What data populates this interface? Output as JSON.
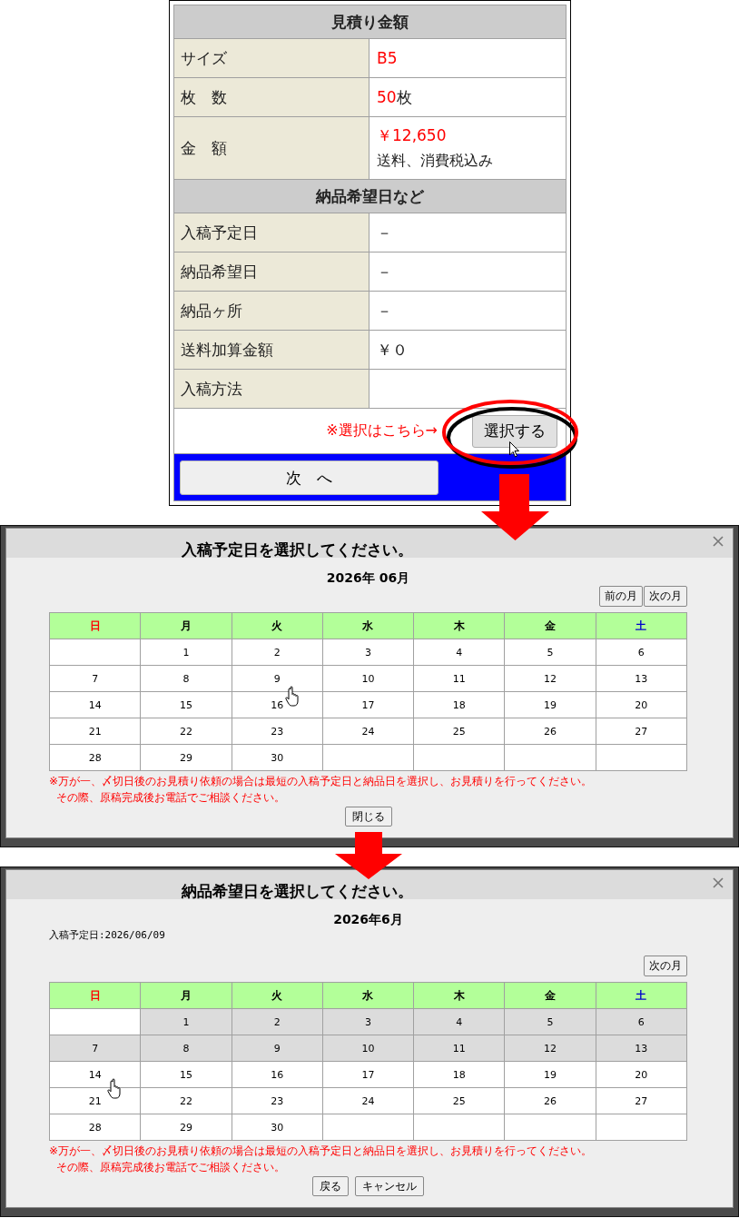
{
  "estimate_panel": {
    "sections": [
      {
        "heading": "見積り金額",
        "rows": [
          {
            "label": "サイズ",
            "value": "B5",
            "emphasized": true
          },
          {
            "label": "枚　数",
            "value": "50",
            "unit": "枚",
            "emphasized": true
          },
          {
            "label": "金　額",
            "value": "￥12,650",
            "emphasized": true,
            "note": "送料、消費税込み"
          }
        ]
      },
      {
        "heading": "納品希望日など",
        "rows": [
          {
            "label": "入稿予定日",
            "value": "－",
            "emphasized": false
          },
          {
            "label": "納品希望日",
            "value": "－",
            "emphasized": false
          },
          {
            "label": "納品ヶ所",
            "value": "－",
            "emphasized": false
          },
          {
            "label": "送料加算金額",
            "value": "￥０",
            "emphasized": false
          },
          {
            "label": "入稿方法"
          }
        ]
      }
    ],
    "select_hint": "※選択はこちら→",
    "select_button": "選択する",
    "next_button": "次　へ"
  },
  "dialogs": [
    {
      "title": "入稿予定日を選択してください。",
      "month": "2026年 06月",
      "nav_buttons": [
        "前の月",
        "次の月"
      ],
      "weekdays": [
        {
          "label": "日",
          "color": "#ff0000"
        },
        {
          "label": "月",
          "color": "#000000"
        },
        {
          "label": "火",
          "color": "#000000"
        },
        {
          "label": "水",
          "color": "#000000"
        },
        {
          "label": "木",
          "color": "#000000"
        },
        {
          "label": "金",
          "color": "#000000"
        },
        {
          "label": "土",
          "color": "#0000cc"
        }
      ],
      "weeks": [
        [
          {
            "day": "1",
            "disabled": false
          },
          {
            "day": "2",
            "disabled": false
          },
          {
            "day": "3",
            "disabled": false
          },
          {
            "day": "4",
            "disabled": false
          },
          {
            "day": "5",
            "disabled": false
          },
          {
            "day": "6",
            "disabled": false
          }
        ],
        [
          {
            "day": "7",
            "disabled": false
          },
          {
            "day": "8",
            "disabled": false
          },
          {
            "day": "9",
            "disabled": false
          },
          {
            "day": "10",
            "disabled": false
          },
          {
            "day": "11",
            "disabled": false
          },
          {
            "day": "12",
            "disabled": false
          },
          {
            "day": "13",
            "disabled": false
          }
        ],
        [
          {
            "day": "14",
            "disabled": false
          },
          {
            "day": "15",
            "disabled": false
          },
          {
            "day": "16",
            "disabled": false
          },
          {
            "day": "17",
            "disabled": false
          },
          {
            "day": "18",
            "disabled": false
          },
          {
            "day": "19",
            "disabled": false
          },
          {
            "day": "20",
            "disabled": false
          }
        ],
        [
          {
            "day": "21",
            "disabled": false
          },
          {
            "day": "22",
            "disabled": false
          },
          {
            "day": "23",
            "disabled": false
          },
          {
            "day": "24",
            "disabled": false
          },
          {
            "day": "25",
            "disabled": false
          },
          {
            "day": "26",
            "disabled": false
          },
          {
            "day": "27",
            "disabled": false
          }
        ],
        [
          {
            "day": "28",
            "disabled": false
          },
          {
            "day": "29",
            "disabled": false
          },
          {
            "day": "30",
            "disabled": false
          }
        ]
      ],
      "notes": [
        "※万が一、〆切日後のお見積り依頼の場合は最短の入稿予定日と納品日を選択し、お見積りを行ってください。",
        "その際、原稿完成後お電話でご相談ください。"
      ],
      "buttons": [
        "閉じる"
      ]
    },
    {
      "title": "納品希望日を選択してください。",
      "month": "2026年6月",
      "start_date": "入稿予定日:2026/06/09",
      "nav_buttons": [
        "次の月"
      ],
      "weekdays": [
        {
          "label": "日",
          "color": "#ff0000"
        },
        {
          "label": "月",
          "color": "#000000"
        },
        {
          "label": "火",
          "color": "#000000"
        },
        {
          "label": "水",
          "color": "#000000"
        },
        {
          "label": "木",
          "color": "#000000"
        },
        {
          "label": "金",
          "color": "#000000"
        },
        {
          "label": "土",
          "color": "#0000cc"
        }
      ],
      "weeks": [
        [
          {
            "day": "1",
            "disabled": true
          },
          {
            "day": "2",
            "disabled": true
          },
          {
            "day": "3",
            "disabled": true
          },
          {
            "day": "4",
            "disabled": true
          },
          {
            "day": "5",
            "disabled": true
          },
          {
            "day": "6",
            "disabled": true
          }
        ],
        [
          {
            "day": "7",
            "disabled": true
          },
          {
            "day": "8",
            "disabled": true
          },
          {
            "day": "9",
            "disabled": true
          },
          {
            "day": "10",
            "disabled": true
          },
          {
            "day": "11",
            "disabled": true
          },
          {
            "day": "12",
            "disabled": true
          },
          {
            "day": "13",
            "disabled": true
          }
        ],
        [
          {
            "day": "14",
            "disabled": false
          },
          {
            "day": "15",
            "disabled": false
          },
          {
            "day": "16",
            "disabled": false
          },
          {
            "day": "17",
            "disabled": false
          },
          {
            "day": "18",
            "disabled": false
          },
          {
            "day": "19",
            "disabled": false
          },
          {
            "day": "20",
            "disabled": false
          }
        ],
        [
          {
            "day": "21",
            "disabled": false
          },
          {
            "day": "22",
            "disabled": false
          },
          {
            "day": "23",
            "disabled": false
          },
          {
            "day": "24",
            "disabled": false
          },
          {
            "day": "25",
            "disabled": false
          },
          {
            "day": "26",
            "disabled": false
          },
          {
            "day": "27",
            "disabled": false
          }
        ],
        [
          {
            "day": "28",
            "disabled": false
          },
          {
            "day": "29",
            "disabled": false
          },
          {
            "day": "30",
            "disabled": false
          }
        ]
      ],
      "notes": [
        "※万が一、〆切日後のお見積り依頼の場合は最短の入稿予定日と納品日を選択し、お見積りを行ってください。",
        "その際、原稿完成後お電話でご相談ください。"
      ],
      "buttons": [
        "戻る",
        "キャンセル"
      ]
    }
  ]
}
